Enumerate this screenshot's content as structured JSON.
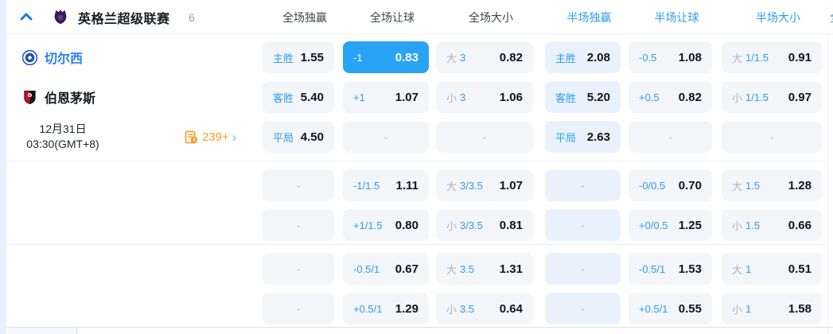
{
  "header": {
    "league": "英格兰超级联赛",
    "match_count": "6",
    "columns": [
      "全场独赢",
      "全场让球",
      "全场大小",
      "半场独赢",
      "半场让球",
      "半场大小"
    ]
  },
  "match": {
    "home_team": "切尔西",
    "away_team": "伯恩茅斯",
    "date": "12月31日",
    "time": "03:30(GMT+8)",
    "more_markets": "239+"
  },
  "clipped_next_column": "全",
  "colors": {
    "accent_blue": "#2e9bf5",
    "selected_blue": "#29a3f5",
    "value_dark": "#10151b",
    "orange": "#fb9e25",
    "cell_bg": "#f3f5f8",
    "cell_bg_tint": "#e9f2fc",
    "home_team_blue": "#2b7df5"
  },
  "odds_rows": [
    {
      "cells": [
        {
          "type": "odds",
          "label": "主胜",
          "value": "1.55"
        },
        {
          "type": "odds",
          "label": "-1",
          "value": "0.83",
          "selected": true
        },
        {
          "type": "ou",
          "prefix": "大",
          "line": "3",
          "value": "0.82"
        },
        {
          "type": "odds",
          "label": "主胜",
          "value": "2.08"
        },
        {
          "type": "odds",
          "label": "-0.5",
          "value": "1.08"
        },
        {
          "type": "ou",
          "prefix": "大",
          "line": "1/1.5",
          "value": "0.91"
        }
      ]
    },
    {
      "cells": [
        {
          "type": "odds",
          "label": "客胜",
          "value": "5.40"
        },
        {
          "type": "odds",
          "label": "+1",
          "value": "1.07"
        },
        {
          "type": "ou",
          "prefix": "小",
          "line": "3",
          "value": "1.06"
        },
        {
          "type": "odds",
          "label": "客胜",
          "value": "5.20"
        },
        {
          "type": "odds",
          "label": "+0.5",
          "value": "0.82"
        },
        {
          "type": "ou",
          "prefix": "小",
          "line": "1/1.5",
          "value": "0.97"
        }
      ]
    },
    {
      "cells": [
        {
          "type": "odds",
          "label": "平局",
          "value": "4.50"
        },
        {
          "type": "dash"
        },
        {
          "type": "dash"
        },
        {
          "type": "odds",
          "label": "平局",
          "value": "2.63"
        },
        {
          "type": "dash"
        },
        {
          "type": "dash"
        }
      ]
    },
    {
      "cells": [
        {
          "type": "dash"
        },
        {
          "type": "odds",
          "label": "-1/1.5",
          "value": "1.11"
        },
        {
          "type": "ou",
          "prefix": "大",
          "line": "3/3.5",
          "value": "1.07"
        },
        {
          "type": "dash"
        },
        {
          "type": "odds",
          "label": "-0/0.5",
          "value": "0.70"
        },
        {
          "type": "ou",
          "prefix": "大",
          "line": "1.5",
          "value": "1.28"
        }
      ]
    },
    {
      "cells": [
        {
          "type": "dash"
        },
        {
          "type": "odds",
          "label": "+1/1.5",
          "value": "0.80"
        },
        {
          "type": "ou",
          "prefix": "小",
          "line": "3/3.5",
          "value": "0.81"
        },
        {
          "type": "dash"
        },
        {
          "type": "odds",
          "label": "+0/0.5",
          "value": "1.25"
        },
        {
          "type": "ou",
          "prefix": "小",
          "line": "1.5",
          "value": "0.66"
        }
      ]
    },
    {
      "cells": [
        {
          "type": "dash"
        },
        {
          "type": "odds",
          "label": "-0.5/1",
          "value": "0.67"
        },
        {
          "type": "ou",
          "prefix": "大",
          "line": "3.5",
          "value": "1.31"
        },
        {
          "type": "dash"
        },
        {
          "type": "odds",
          "label": "-0.5/1",
          "value": "1.53"
        },
        {
          "type": "ou",
          "prefix": "大",
          "line": "1",
          "value": "0.51"
        }
      ]
    },
    {
      "cells": [
        {
          "type": "dash"
        },
        {
          "type": "odds",
          "label": "+0.5/1",
          "value": "1.29"
        },
        {
          "type": "ou",
          "prefix": "小",
          "line": "3.5",
          "value": "0.64"
        },
        {
          "type": "dash"
        },
        {
          "type": "odds",
          "label": "+0.5/1",
          "value": "0.55"
        },
        {
          "type": "ou",
          "prefix": "小",
          "line": "1",
          "value": "1.58"
        }
      ]
    }
  ]
}
